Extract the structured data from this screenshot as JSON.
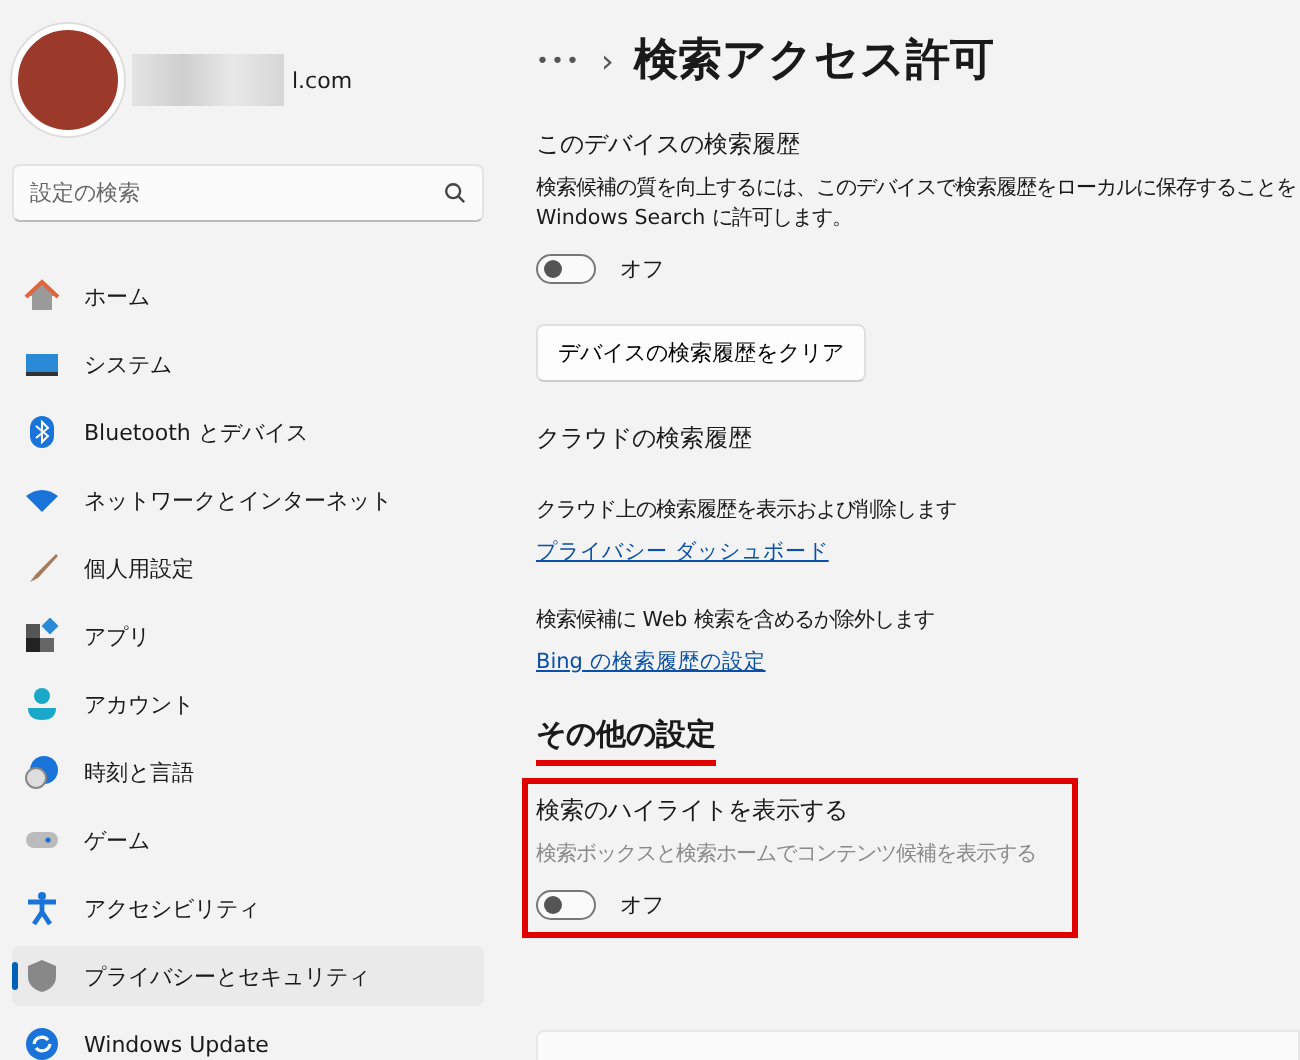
{
  "account": {
    "email": "l.com"
  },
  "search": {
    "placeholder": "設定の検索"
  },
  "nav": [
    {
      "kind": "home",
      "label": "ホーム",
      "selected": false
    },
    {
      "kind": "system",
      "label": "システム",
      "selected": false
    },
    {
      "kind": "bluetooth",
      "label": "Bluetooth とデバイス",
      "selected": false
    },
    {
      "kind": "network",
      "label": "ネットワークとインターネット",
      "selected": false
    },
    {
      "kind": "brush",
      "label": "個人用設定",
      "selected": false
    },
    {
      "kind": "apps",
      "label": "アプリ",
      "selected": false
    },
    {
      "kind": "account",
      "label": "アカウント",
      "selected": false
    },
    {
      "kind": "time",
      "label": "時刻と言語",
      "selected": false
    },
    {
      "kind": "game",
      "label": "ゲーム",
      "selected": false
    },
    {
      "kind": "accessibility",
      "label": "アクセシビリティ",
      "selected": false
    },
    {
      "kind": "shield",
      "label": "プライバシーとセキュリティ",
      "selected": true
    },
    {
      "kind": "update",
      "label": "Windows Update",
      "selected": false
    }
  ],
  "breadcrumb": {
    "more": "•••",
    "separator": "›",
    "title": "検索アクセス許可"
  },
  "sections": [
    {
      "kind": "setting",
      "title": "このデバイスの検索履歴",
      "description": "検索候補の質を向上するには、このデバイスで検索履歴をローカルに保存することを\nWindows Search に許可します。",
      "toggle": {
        "on": false,
        "label": "オフ"
      },
      "button": "デバイスの検索履歴をクリア"
    },
    {
      "kind": "setting",
      "title": "クラウドの検索履歴"
    },
    {
      "kind": "link",
      "description": "クラウド上の検索履歴を表示および削除します",
      "link": "プライバシー ダッシュボード"
    },
    {
      "kind": "link",
      "description": "検索候補に Web 検索を含めるか除外します",
      "link": "Bing の検索履歴の設定"
    },
    {
      "kind": "heading",
      "title": "その他の設定",
      "underlined": true
    },
    {
      "kind": "setting",
      "title": "検索のハイライトを表示する",
      "description": "検索ボックスと検索ホームでコンテンツ候補を表示する",
      "muted": true,
      "toggle": {
        "on": false,
        "label": "オフ"
      },
      "framed": true
    }
  ]
}
